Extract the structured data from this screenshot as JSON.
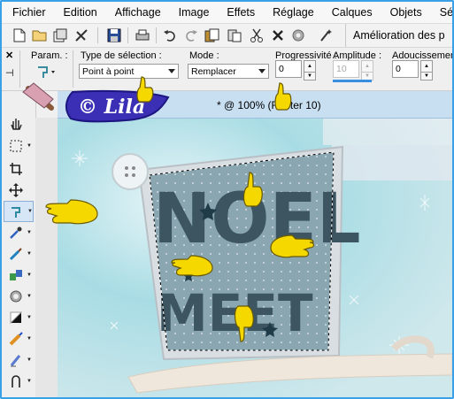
{
  "menu": [
    "Fichier",
    "Edition",
    "Affichage",
    "Image",
    "Effets",
    "Réglage",
    "Calques",
    "Objets",
    "Sélection"
  ],
  "toolbar": {
    "icons": [
      "new-file-icon",
      "open-folder-icon",
      "browse-icon",
      "scan-icon",
      "save-icon",
      "print-icon",
      "undo-icon",
      "redo-icon",
      "copy-icon",
      "paste-icon",
      "cut-icon",
      "delete-icon",
      "settings-icon",
      "magic-icon"
    ],
    "enhancement_label": "Amélioration des p"
  },
  "tool_options": {
    "param_label": "Param. :",
    "selection_type_label": "Type de sélection :",
    "selection_type_value": "Point à point",
    "mode_label": "Mode :",
    "mode_value": "Remplacer",
    "progressivity_label": "Progressivité :",
    "progressivity_value": "0",
    "amplitude_label": "Amplitude :",
    "amplitude_value": "10",
    "smoothing_label": "Adoucissement :",
    "smoothing_value": "0"
  },
  "tools": [
    "pan-icon",
    "selection-rect-icon",
    "crop-icon",
    "move-icon",
    "freehand-selection-icon",
    "dropper-icon",
    "brush-icon",
    "clone-icon",
    "retouch-icon",
    "contrast-icon",
    "color-replace-icon",
    "eraser-icon",
    "text-icon"
  ],
  "document": {
    "title": "* @ 100% (Raster 10)"
  },
  "canvas_art": {
    "letters_top": "NOEL",
    "letters_bottom": "MEET"
  },
  "watermark": {
    "text": "© Lila"
  },
  "colors": {
    "canvas_bg": "#b9dfe6",
    "pointer_yellow": "#f5d800",
    "logo_purple": "#3a2fb5",
    "frame_border": "#3aa0e8"
  }
}
